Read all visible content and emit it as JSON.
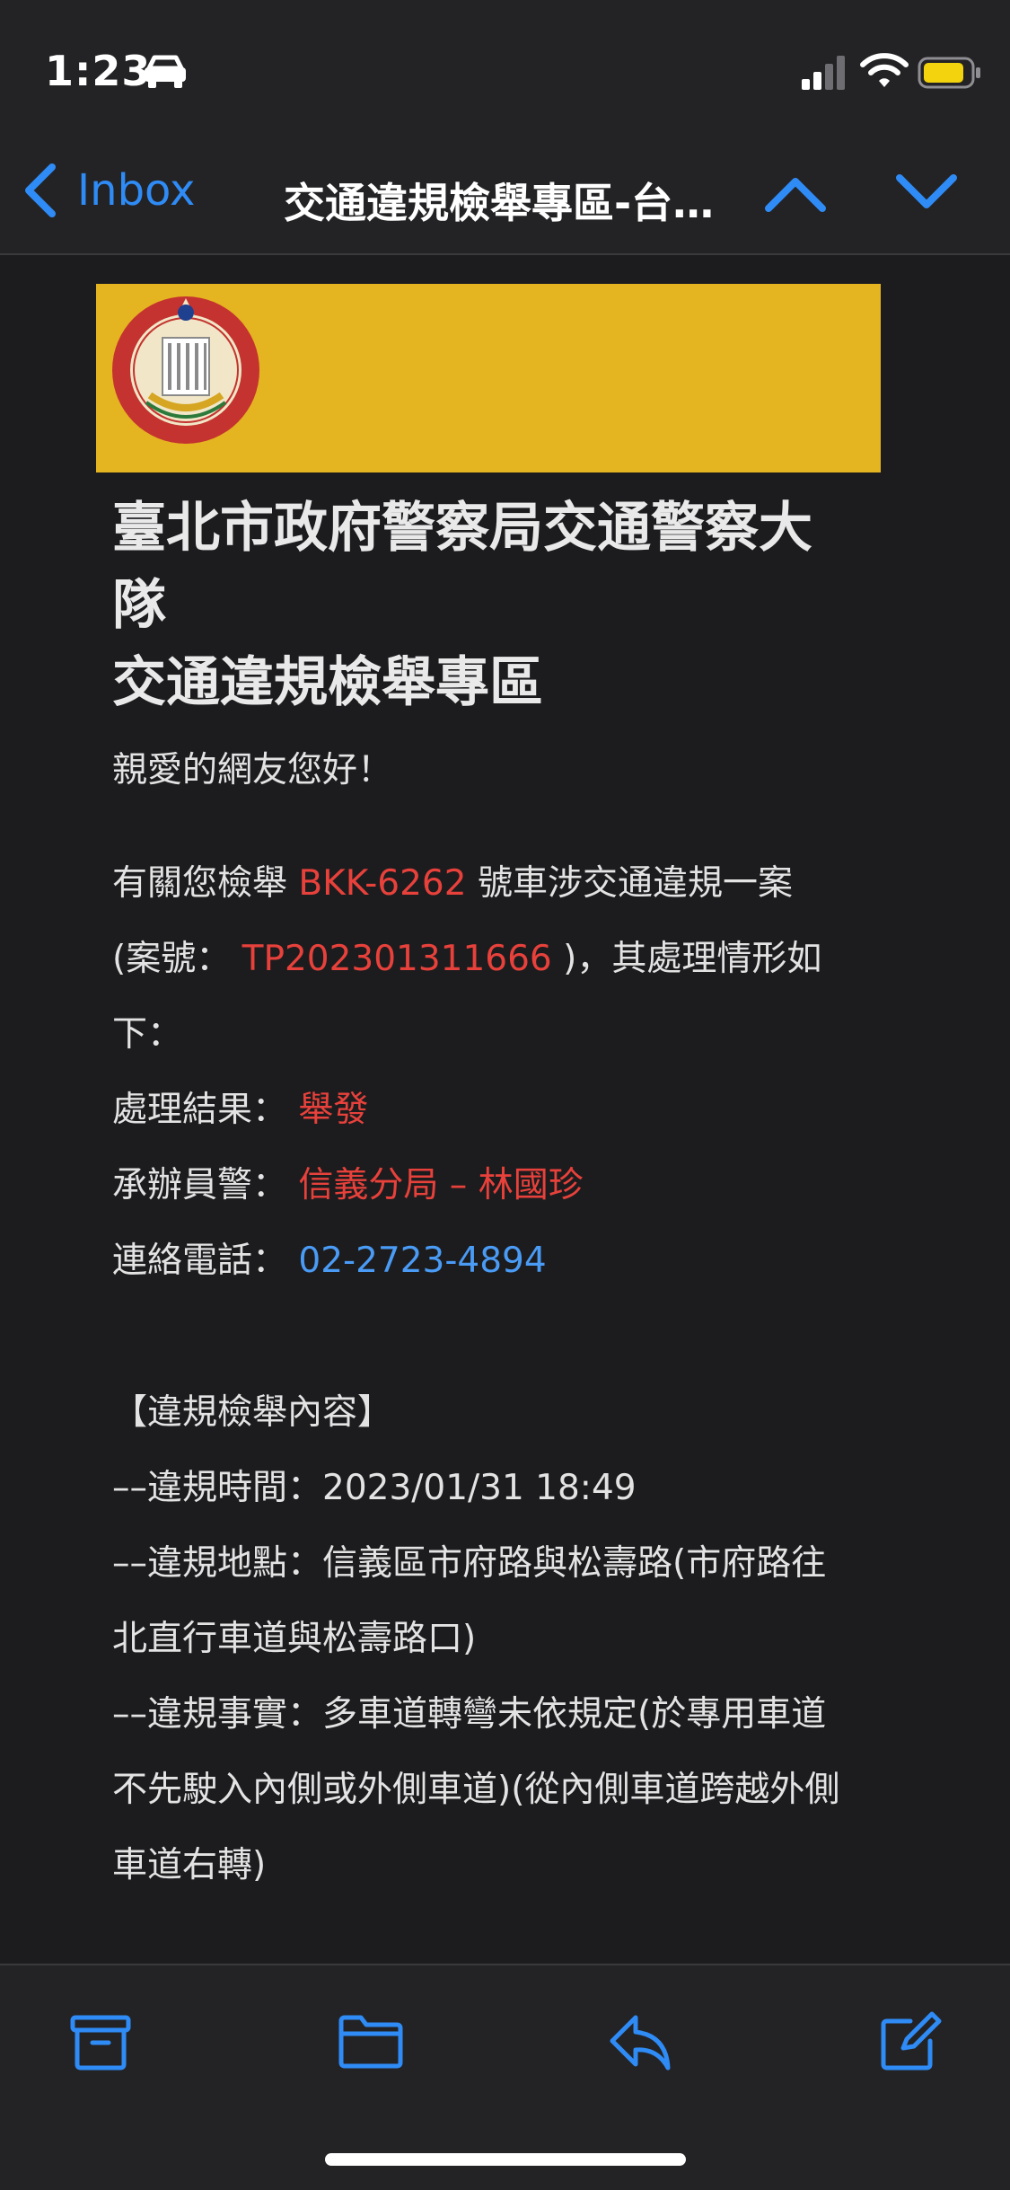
{
  "status": {
    "time": "1:23",
    "car_icon": "car-icon",
    "battery_color": "#f2d30d"
  },
  "nav": {
    "back_label": "Inbox",
    "title": "交通違規檢舉專區-台北市政府警察局交通警察大隊"
  },
  "email": {
    "heading_line1": "臺北市政府警察局交通警察大",
    "heading_line2": "隊",
    "heading_line3": "交通違規檢舉專區",
    "greeting": "親愛的網友您好！",
    "p1_prefix": "有關您檢舉 ",
    "plate": "BKK-6262",
    "p1_suffix": " 號車涉交通違規一案",
    "p2_prefix": "(案號： ",
    "case_no": "TP202301311666",
    "p2_suffix": " )，其處理情形如",
    "p3": "下：",
    "result_label": "處理結果： ",
    "result_value": "舉發",
    "officer_label": "承辦員警： ",
    "officer_value": "信義分局 – 林國珍",
    "phone_label": "連絡電話： ",
    "phone_value": "02-2723-4894",
    "section_title": "【違規檢舉內容】",
    "time_line": "––違規時間：2023/01/31 18:49",
    "location_line1": "––違規地點：信義區市府路與松壽路(市府路往",
    "location_line2": "北直行車道與松壽路口)",
    "fact_line1": "––違規事實：多車道轉彎未依規定(於專用車道",
    "fact_line2": "不先駛入內側或外側車道)(從內側車道跨越外側",
    "fact_line3": "車道右轉)"
  },
  "colors": {
    "accent": "#2f8bf5",
    "highlight_red": "#e8413b",
    "link_blue": "#4a9bf5",
    "banner": "#e5b421"
  },
  "toolbar": {
    "icons": [
      "archive-icon",
      "folder-icon",
      "reply-icon",
      "compose-icon"
    ]
  }
}
